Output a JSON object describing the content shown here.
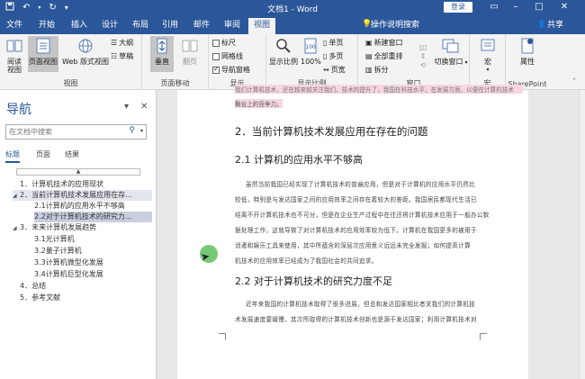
{
  "titlebar": {
    "title": "文档1 - Word",
    "login": "登录",
    "quick_access": [
      "save-icon",
      "undo-icon",
      "redo-icon",
      "customize-icon"
    ]
  },
  "tabs": [
    {
      "label": "文件"
    },
    {
      "label": "开始"
    },
    {
      "label": "插入"
    },
    {
      "label": "设计"
    },
    {
      "label": "布局"
    },
    {
      "label": "引用"
    },
    {
      "label": "邮件"
    },
    {
      "label": "审阅"
    },
    {
      "label": "视图",
      "active": true
    }
  ],
  "tellme": "操作说明搜索",
  "share": "共享",
  "ribbon": {
    "view": {
      "label": "视图",
      "read_mode": "阅读视图",
      "print_layout": "页面视图",
      "web_layout": "Web 版式视图",
      "outline": "大纲",
      "draft": "草稿"
    },
    "page_move": {
      "label": "页面移动",
      "vertical": "垂直",
      "side_by_side": "翻页"
    },
    "show": {
      "label": "显示",
      "ruler": "标尺",
      "gridlines": "网格线",
      "nav_pane": "导航窗格",
      "ruler_checked": false,
      "gridlines_checked": false,
      "nav_checked": true
    },
    "zoom": {
      "label": "显示比例",
      "zoom": "显示比例",
      "percent": "100%",
      "one_page": "单页",
      "multi_page": "多页",
      "page_width": "页宽"
    },
    "window": {
      "label": "窗口",
      "new_window": "新建窗口",
      "arrange_all": "全部重排",
      "split": "拆分",
      "switch": "切换窗口"
    },
    "macros": {
      "label": "宏",
      "macros": "宏"
    },
    "sharepoint": {
      "label": "SharePoint",
      "properties": "属性"
    }
  },
  "nav": {
    "title": "导航",
    "search_placeholder": "在文档中搜索",
    "tabs": [
      "标题",
      "页面",
      "结果"
    ],
    "items": [
      {
        "text": "1．计算机技术的应用现状",
        "level": 1
      },
      {
        "text": "2．当前计算机技术发展应用在存...",
        "level": 1,
        "hl": "hl2"
      },
      {
        "text": "2.1计算机的应用水平不够高",
        "level": 2
      },
      {
        "text": "2.2对于计算机技术的研究力...",
        "level": 2,
        "hl": "hl"
      },
      {
        "text": "3．未来计算机发展趋势",
        "level": 1
      },
      {
        "text": "3.1光计算机",
        "level": 2
      },
      {
        "text": "3.2量子计算机",
        "level": 2
      },
      {
        "text": "3.3计算机微型化发展",
        "level": 2
      },
      {
        "text": "3.4计算机巨型化发展",
        "level": 2
      },
      {
        "text": "4．总结",
        "level": 1
      },
      {
        "text": "5．参考文献",
        "level": 1
      }
    ]
  },
  "doc": {
    "frag1": "我们计算机技术，还在越来越关注我们，技术的提升了，我国在科技水平，在发展方面，以便在计算机技术",
    "frag2": "舞台上的竞争力。",
    "h1": "2．当前计算机技术发展应用在存在的问题",
    "h21": "2.1 计算机的应用水平不够高",
    "p1_l1": "虽然当前我国已经实现了计算机技术的普遍应用，但是对于计算机的应用水平仍然比",
    "p1_l2": "较低，特别是与发达国家之间的应用效率之间存在着较大的差距。我国居民都现代生活已",
    "p1_l3": "经离不开计算机技术也不可分，但是在企业生产过程中在往还将计算机技术应用于一般办公数",
    "p1_l4": "据处理工作，这就导致了对计算机技术的应用效率较为低下。计算机在我国更多的被用于",
    "p1_l5": "消遣和娱乐工具来使用，其中所蕴含的深层次应用意义远远未完全发掘；如何提高计算",
    "p1_l6": "机技术的应用效率已经成为了我国社会的共同追求。",
    "h22": "2.2 对于计算机技术的研究力度不足",
    "p2_l1": "近年来我国的计算机技术取得了很多进展，但总和发达国家相比者关我们的计算机技",
    "p2_l2": "术发展速度要缓慢，其次所取得的计算机技术创新也是源于发达国家；利用计算机技术对"
  },
  "colors": {
    "brand": "#2b579a",
    "highlight": "#f7d6e0",
    "nav_selected": "#c9cfe0"
  }
}
